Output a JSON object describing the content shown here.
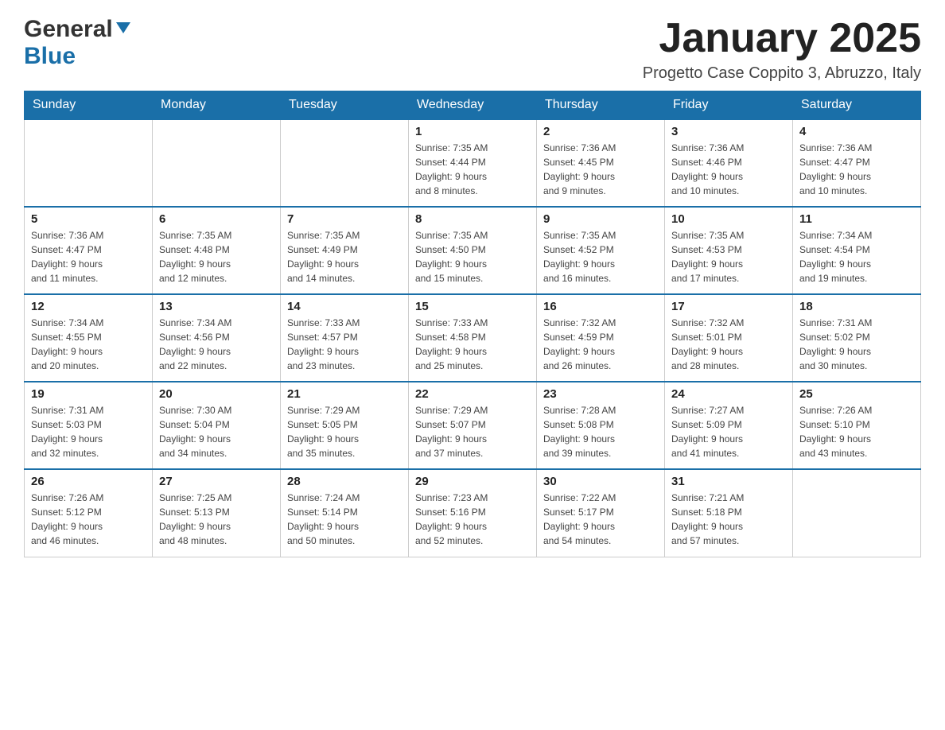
{
  "header": {
    "logo_general": "General",
    "logo_blue": "Blue",
    "month_title": "January 2025",
    "location": "Progetto Case Coppito 3, Abruzzo, Italy"
  },
  "days_of_week": [
    "Sunday",
    "Monday",
    "Tuesday",
    "Wednesday",
    "Thursday",
    "Friday",
    "Saturday"
  ],
  "weeks": [
    [
      {
        "day": "",
        "info": ""
      },
      {
        "day": "",
        "info": ""
      },
      {
        "day": "",
        "info": ""
      },
      {
        "day": "1",
        "info": "Sunrise: 7:35 AM\nSunset: 4:44 PM\nDaylight: 9 hours\nand 8 minutes."
      },
      {
        "day": "2",
        "info": "Sunrise: 7:36 AM\nSunset: 4:45 PM\nDaylight: 9 hours\nand 9 minutes."
      },
      {
        "day": "3",
        "info": "Sunrise: 7:36 AM\nSunset: 4:46 PM\nDaylight: 9 hours\nand 10 minutes."
      },
      {
        "day": "4",
        "info": "Sunrise: 7:36 AM\nSunset: 4:47 PM\nDaylight: 9 hours\nand 10 minutes."
      }
    ],
    [
      {
        "day": "5",
        "info": "Sunrise: 7:36 AM\nSunset: 4:47 PM\nDaylight: 9 hours\nand 11 minutes."
      },
      {
        "day": "6",
        "info": "Sunrise: 7:35 AM\nSunset: 4:48 PM\nDaylight: 9 hours\nand 12 minutes."
      },
      {
        "day": "7",
        "info": "Sunrise: 7:35 AM\nSunset: 4:49 PM\nDaylight: 9 hours\nand 14 minutes."
      },
      {
        "day": "8",
        "info": "Sunrise: 7:35 AM\nSunset: 4:50 PM\nDaylight: 9 hours\nand 15 minutes."
      },
      {
        "day": "9",
        "info": "Sunrise: 7:35 AM\nSunset: 4:52 PM\nDaylight: 9 hours\nand 16 minutes."
      },
      {
        "day": "10",
        "info": "Sunrise: 7:35 AM\nSunset: 4:53 PM\nDaylight: 9 hours\nand 17 minutes."
      },
      {
        "day": "11",
        "info": "Sunrise: 7:34 AM\nSunset: 4:54 PM\nDaylight: 9 hours\nand 19 minutes."
      }
    ],
    [
      {
        "day": "12",
        "info": "Sunrise: 7:34 AM\nSunset: 4:55 PM\nDaylight: 9 hours\nand 20 minutes."
      },
      {
        "day": "13",
        "info": "Sunrise: 7:34 AM\nSunset: 4:56 PM\nDaylight: 9 hours\nand 22 minutes."
      },
      {
        "day": "14",
        "info": "Sunrise: 7:33 AM\nSunset: 4:57 PM\nDaylight: 9 hours\nand 23 minutes."
      },
      {
        "day": "15",
        "info": "Sunrise: 7:33 AM\nSunset: 4:58 PM\nDaylight: 9 hours\nand 25 minutes."
      },
      {
        "day": "16",
        "info": "Sunrise: 7:32 AM\nSunset: 4:59 PM\nDaylight: 9 hours\nand 26 minutes."
      },
      {
        "day": "17",
        "info": "Sunrise: 7:32 AM\nSunset: 5:01 PM\nDaylight: 9 hours\nand 28 minutes."
      },
      {
        "day": "18",
        "info": "Sunrise: 7:31 AM\nSunset: 5:02 PM\nDaylight: 9 hours\nand 30 minutes."
      }
    ],
    [
      {
        "day": "19",
        "info": "Sunrise: 7:31 AM\nSunset: 5:03 PM\nDaylight: 9 hours\nand 32 minutes."
      },
      {
        "day": "20",
        "info": "Sunrise: 7:30 AM\nSunset: 5:04 PM\nDaylight: 9 hours\nand 34 minutes."
      },
      {
        "day": "21",
        "info": "Sunrise: 7:29 AM\nSunset: 5:05 PM\nDaylight: 9 hours\nand 35 minutes."
      },
      {
        "day": "22",
        "info": "Sunrise: 7:29 AM\nSunset: 5:07 PM\nDaylight: 9 hours\nand 37 minutes."
      },
      {
        "day": "23",
        "info": "Sunrise: 7:28 AM\nSunset: 5:08 PM\nDaylight: 9 hours\nand 39 minutes."
      },
      {
        "day": "24",
        "info": "Sunrise: 7:27 AM\nSunset: 5:09 PM\nDaylight: 9 hours\nand 41 minutes."
      },
      {
        "day": "25",
        "info": "Sunrise: 7:26 AM\nSunset: 5:10 PM\nDaylight: 9 hours\nand 43 minutes."
      }
    ],
    [
      {
        "day": "26",
        "info": "Sunrise: 7:26 AM\nSunset: 5:12 PM\nDaylight: 9 hours\nand 46 minutes."
      },
      {
        "day": "27",
        "info": "Sunrise: 7:25 AM\nSunset: 5:13 PM\nDaylight: 9 hours\nand 48 minutes."
      },
      {
        "day": "28",
        "info": "Sunrise: 7:24 AM\nSunset: 5:14 PM\nDaylight: 9 hours\nand 50 minutes."
      },
      {
        "day": "29",
        "info": "Sunrise: 7:23 AM\nSunset: 5:16 PM\nDaylight: 9 hours\nand 52 minutes."
      },
      {
        "day": "30",
        "info": "Sunrise: 7:22 AM\nSunset: 5:17 PM\nDaylight: 9 hours\nand 54 minutes."
      },
      {
        "day": "31",
        "info": "Sunrise: 7:21 AM\nSunset: 5:18 PM\nDaylight: 9 hours\nand 57 minutes."
      },
      {
        "day": "",
        "info": ""
      }
    ]
  ]
}
